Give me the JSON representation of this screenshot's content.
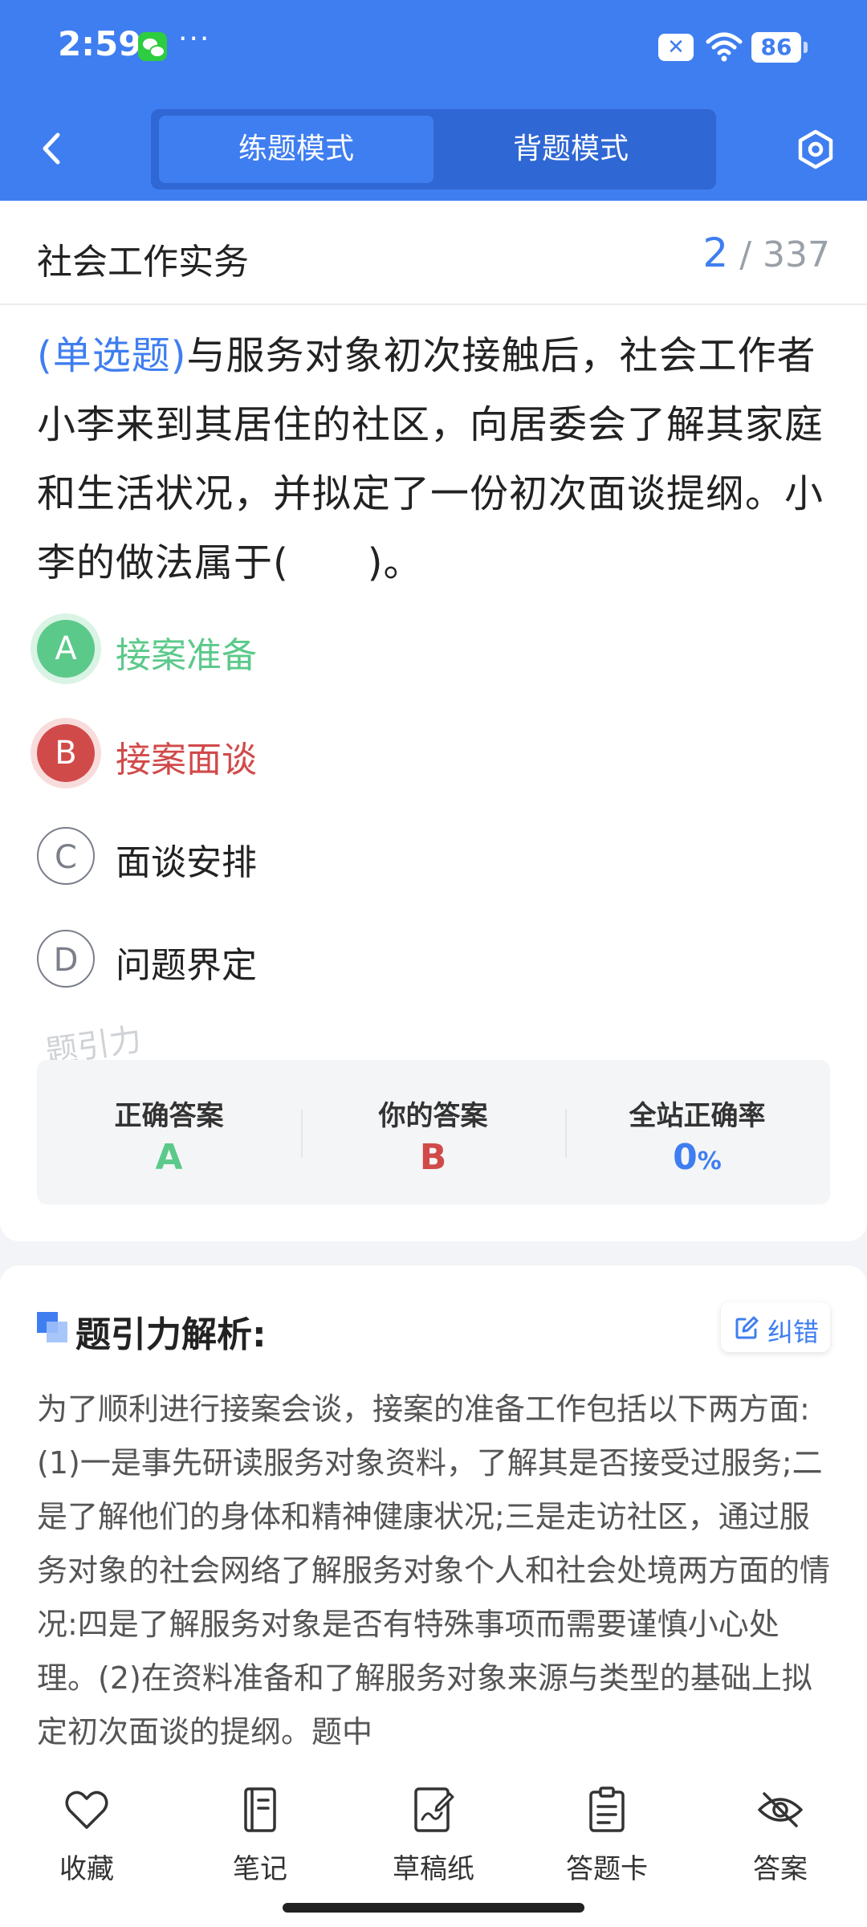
{
  "status_bar": {
    "time": "2:59",
    "dots": "···",
    "battery": "86"
  },
  "header": {
    "mode_tabs": [
      {
        "label": "练题模式",
        "active": true
      },
      {
        "label": "背题模式",
        "active": false
      }
    ]
  },
  "question_card": {
    "subject": "社会工作实务",
    "progress_current": "2",
    "progress_total": "/ 337",
    "question_type": "(单选题)",
    "question_text": "与服务对象初次接触后，社会工作者小李来到其居住的社区，向居委会了解其家庭和生活状况，并拟定了一份初次面谈提纲。小李的做法属于(　　)。",
    "options": [
      {
        "letter": "A",
        "text": "接案准备",
        "state": "correct"
      },
      {
        "letter": "B",
        "text": "接案面谈",
        "state": "wrong"
      },
      {
        "letter": "C",
        "text": "面谈安排",
        "state": "normal"
      },
      {
        "letter": "D",
        "text": "问题界定",
        "state": "normal"
      }
    ],
    "watermark": "题引力",
    "stats": {
      "correct_label": "正确答案",
      "correct_value": "A",
      "yours_label": "你的答案",
      "yours_value": "B",
      "rate_label": "全站正确率",
      "rate_value": "0",
      "rate_unit": "%"
    }
  },
  "analysis": {
    "title": "题引力解析:",
    "report_label": "纠错",
    "body": "为了顺利进行接案会谈，接案的准备工作包括以下两方面:(1)一是事先研读服务对象资料，了解其是否接受过服务;二是了解他们的身体和精神健康状况;三是走访社区，通过服务对象的社会网络了解服务对象个人和社会处境两方面的情况:四是了解服务对象是否有特殊事项而需要谨慎小心处理。(2)在资料准备和了解服务对象来源与类型的基础上拟定初次面谈的提纲。题中"
  },
  "bottom_nav": [
    {
      "label": "收藏",
      "icon": "heart-icon"
    },
    {
      "label": "笔记",
      "icon": "notebook-icon"
    },
    {
      "label": "草稿纸",
      "icon": "draft-icon"
    },
    {
      "label": "答题卡",
      "icon": "clipboard-icon"
    },
    {
      "label": "答案",
      "icon": "eye-off-icon"
    }
  ],
  "colors": {
    "brand": "#3f7ef0",
    "correct": "#5bc98a",
    "wrong": "#d14a4a"
  }
}
